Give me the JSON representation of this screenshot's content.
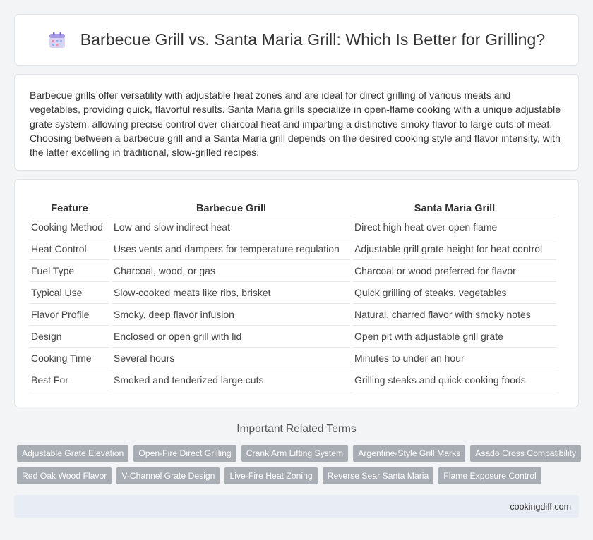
{
  "header": {
    "icon": "calendar-icon",
    "title": "Barbecue Grill vs. Santa Maria Grill: Which Is Better for Grilling?"
  },
  "intro": {
    "text": "Barbecue grills offer versatility with adjustable heat zones and are ideal for direct grilling of various meats and vegetables, providing quick, flavorful results. Santa Maria grills specialize in open-flame cooking with a unique adjustable grate system, allowing precise control over charcoal heat and imparting a distinctive smoky flavor to large cuts of meat. Choosing between a barbecue grill and a Santa Maria grill depends on the desired cooking style and flavor intensity, with the latter excelling in traditional, slow-grilled recipes."
  },
  "table": {
    "headers": [
      "Feature",
      "Barbecue Grill",
      "Santa Maria Grill"
    ],
    "rows": [
      [
        "Cooking Method",
        "Low and slow indirect heat",
        "Direct high heat over open flame"
      ],
      [
        "Heat Control",
        "Uses vents and dampers for temperature regulation",
        "Adjustable grill grate height for heat control"
      ],
      [
        "Fuel Type",
        "Charcoal, wood, or gas",
        "Charcoal or wood preferred for flavor"
      ],
      [
        "Typical Use",
        "Slow-cooked meats like ribs, brisket",
        "Quick grilling of steaks, vegetables"
      ],
      [
        "Flavor Profile",
        "Smoky, deep flavor infusion",
        "Natural, charred flavor with smoky notes"
      ],
      [
        "Design",
        "Enclosed or open grill with lid",
        "Open pit with adjustable grill grate"
      ],
      [
        "Cooking Time",
        "Several hours",
        "Minutes to under an hour"
      ],
      [
        "Best For",
        "Smoked and tenderized large cuts",
        "Grilling steaks and quick-cooking foods"
      ]
    ]
  },
  "related": {
    "title": "Important Related Terms",
    "tags": [
      [
        "Adjustable Grate Elevation",
        "Open-Fire Direct Grilling",
        "Crank Arm Lifting System",
        "Argentine-Style Grill Marks",
        "Asado Cross Compatibility"
      ],
      [
        "Red Oak Wood Flavor",
        "V-Channel Grate Design",
        "Live-Fire Heat Zoning",
        "Reverse Sear Santa Maria",
        "Flame Exposure Control"
      ]
    ]
  },
  "footer": {
    "site": "cookingdiff.com"
  }
}
